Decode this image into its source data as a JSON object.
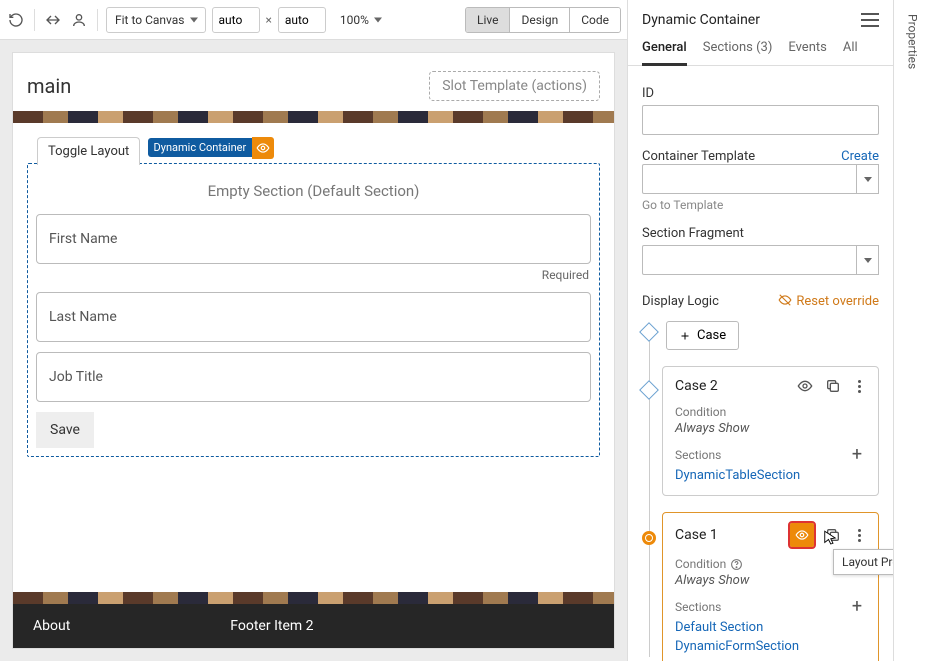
{
  "toolbar": {
    "fit": "Fit to Canvas",
    "w": "auto",
    "h": "auto",
    "zoom": "100%",
    "modes": [
      "Live",
      "Design",
      "Code"
    ],
    "active_mode": "Live"
  },
  "canvas": {
    "page_title": "main",
    "slot_label": "Slot Template (actions)",
    "toggle_tab": "Toggle Layout",
    "chip_label": "Dynamic Container",
    "empty_section": "Empty Section (Default Section)",
    "fields": {
      "first": "First Name",
      "last": "Last Name",
      "job": "Job Title"
    },
    "required": "Required",
    "save": "Save",
    "footer": {
      "col1": "About",
      "col2": "Footer Item 2"
    }
  },
  "panel": {
    "title": "Dynamic Container",
    "tabs": {
      "general": "General",
      "sections": "Sections (3)",
      "events": "Events",
      "all": "All"
    },
    "id_label": "ID",
    "ct_label": "Container Template",
    "create": "Create",
    "goto": "Go to Template",
    "sf_label": "Section Fragment",
    "dl_label": "Display Logic",
    "reset": "Reset override",
    "add_case": "Case",
    "case2": {
      "title": "Case 2",
      "cond_label": "Condition",
      "cond_val": "Always Show",
      "sec_label": "Sections",
      "sections": [
        "DynamicTableSection"
      ]
    },
    "case1": {
      "title": "Case 1",
      "cond_label": "Condition",
      "cond_val": "Always Show",
      "sec_label": "Sections",
      "sections": [
        "Default Section",
        "DynamicFormSection"
      ]
    },
    "tooltip": "Layout Preview"
  },
  "rail": {
    "label": "Properties"
  }
}
